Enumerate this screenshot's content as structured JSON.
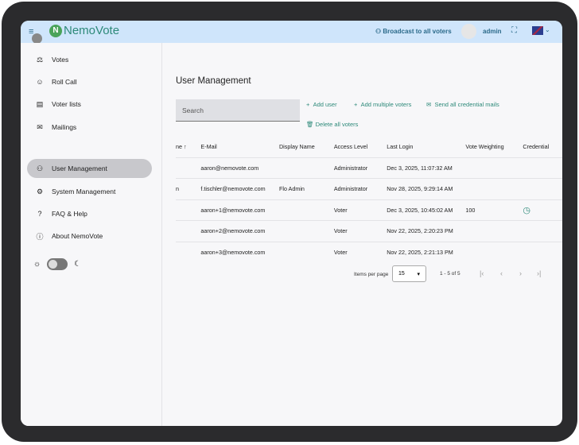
{
  "header": {
    "brand": "NemoVote",
    "broadcast": "Broadcast to all voters",
    "user": "admin"
  },
  "sidebar": {
    "items": [
      {
        "label": "Votes",
        "icon": "ballot-icon"
      },
      {
        "label": "Roll Call",
        "icon": "person-check-icon"
      },
      {
        "label": "Voter lists",
        "icon": "list-icon"
      },
      {
        "label": "Mailings",
        "icon": "mail-icon"
      },
      {
        "label": "User Management",
        "icon": "users-icon",
        "active": true
      },
      {
        "label": "System Management",
        "icon": "gear-icon"
      },
      {
        "label": "FAQ & Help",
        "icon": "question-icon"
      },
      {
        "label": "About NemoVote",
        "icon": "info-icon"
      }
    ]
  },
  "main": {
    "title": "User Management",
    "search_placeholder": "Search",
    "actions": {
      "add_user": "Add user",
      "add_multiple": "Add multiple voters",
      "send_mails": "Send all credential mails",
      "delete_all": "Delete all voters"
    },
    "columns": [
      "ne",
      "E-Mail",
      "Display Name",
      "Access Level",
      "Last Login",
      "Vote Weighting",
      "Credential"
    ],
    "rows": [
      [
        "",
        "aaron@nemovote.com",
        "",
        "Administrator",
        "Dec 3, 2025, 11:07:32 AM",
        "",
        ""
      ],
      [
        "n",
        "f.tischler@nemovote.com",
        "Flo Admin",
        "Administrator",
        "Nov 28, 2025, 9:29:14 AM",
        "",
        ""
      ],
      [
        "",
        "aaron+1@nemovote.com",
        "",
        "Voter",
        "Dec 3, 2025, 10:45:02 AM",
        "100",
        "clock"
      ],
      [
        "",
        "aaron+2@nemovote.com",
        "",
        "Voter",
        "Nov 22, 2025, 2:20:23 PM",
        "",
        ""
      ],
      [
        "",
        "aaron+3@nemovote.com",
        "",
        "Voter",
        "Nov 22, 2025, 2:21:13 PM",
        "",
        ""
      ]
    ],
    "paginator": {
      "label": "Items per page",
      "size": "15",
      "range": "1 - 5 of 5"
    }
  },
  "colors": {
    "accent": "#2e8a7a",
    "header": "#cfe5fb"
  }
}
